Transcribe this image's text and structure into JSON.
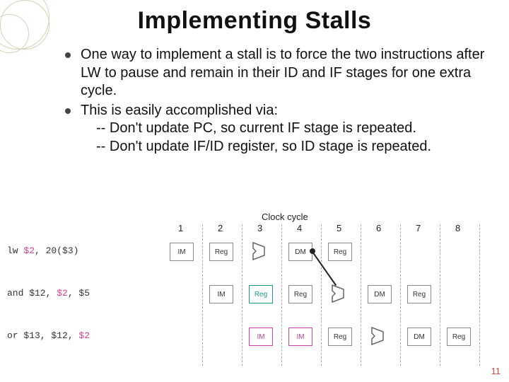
{
  "title": "Implementing Stalls",
  "bullets": [
    {
      "text": "One way to implement a stall is to force the two instructions after LW to pause and remain in their ID and IF stages for one extra cycle."
    },
    {
      "text": "This is easily accomplished via:",
      "subs": [
        "-- Don't update PC, so current IF stage is repeated.",
        "-- Don't update IF/ID register, so ID stage is repeated."
      ]
    }
  ],
  "diagram": {
    "clock_label": "Clock cycle",
    "cycles": [
      "1",
      "2",
      "3",
      "4",
      "5",
      "6",
      "7",
      "8"
    ],
    "rows": [
      {
        "instr_parts": [
          {
            "t": "lw   ",
            "c": ""
          },
          {
            "t": "$2",
            "c": "reg2"
          },
          {
            "t": ", 20($3)",
            "c": ""
          }
        ],
        "stages": [
          "IM",
          "Reg",
          "ALU",
          "DM",
          "Reg",
          "",
          "",
          ""
        ],
        "style_map": [
          "",
          "",
          "",
          "",
          "",
          "",
          "",
          ""
        ]
      },
      {
        "instr_parts": [
          {
            "t": "and $12, ",
            "c": ""
          },
          {
            "t": "$2",
            "c": "reg2"
          },
          {
            "t": ", $5",
            "c": ""
          }
        ],
        "stages": [
          "",
          "IM",
          "Reg",
          "Reg",
          "ALU",
          "DM",
          "Reg",
          ""
        ],
        "style_map": [
          "",
          "",
          "teal",
          "",
          "",
          "",
          "",
          ""
        ]
      },
      {
        "instr_parts": [
          {
            "t": "or  $13, $12, ",
            "c": ""
          },
          {
            "t": "$2",
            "c": "reg2"
          }
        ],
        "stages": [
          "",
          "",
          "IM",
          "IM",
          "Reg",
          "ALU",
          "DM",
          "Reg"
        ],
        "style_map": [
          "",
          "",
          "pink",
          "pink",
          "",
          "",
          "",
          ""
        ]
      }
    ]
  },
  "page_number": "11"
}
